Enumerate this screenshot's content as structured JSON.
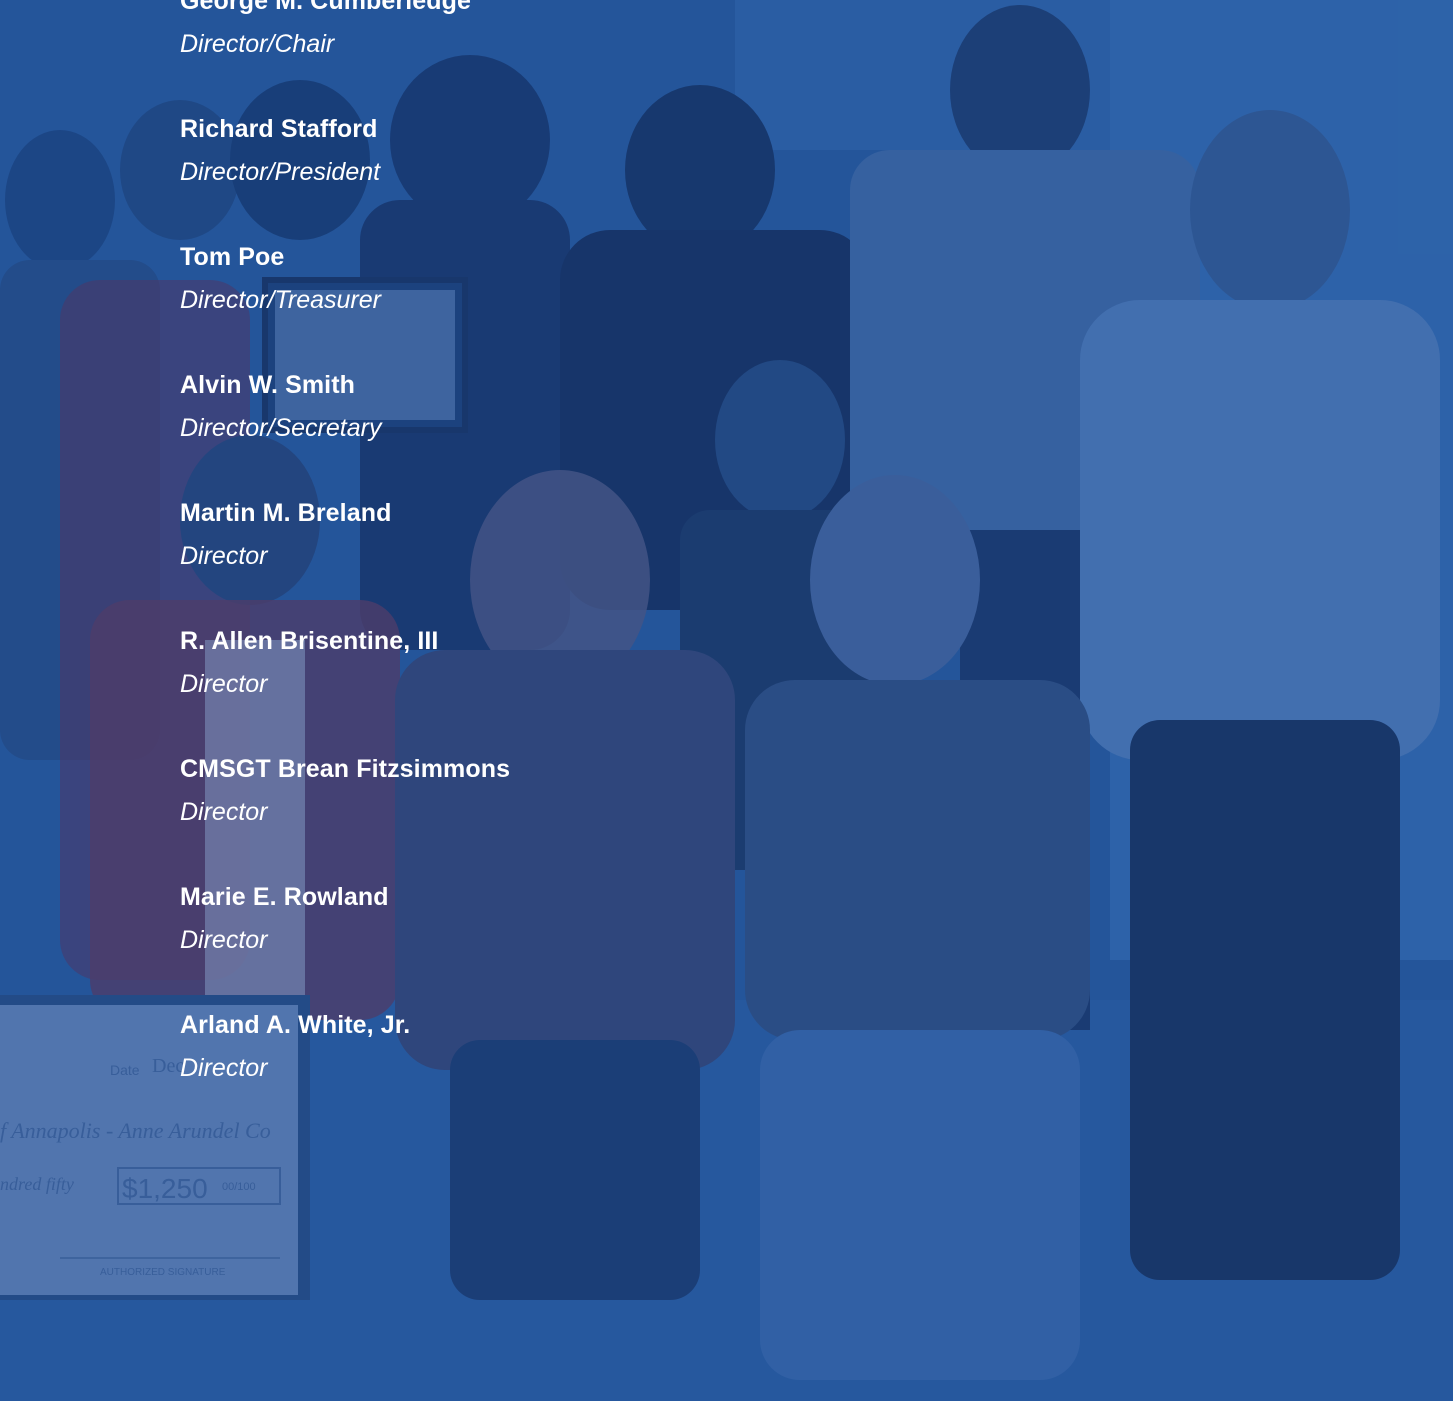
{
  "board": {
    "directors": [
      {
        "name": "George M. Cumberledge",
        "role": "Director/Chair"
      },
      {
        "name": "Richard Stafford",
        "role": "Director/President"
      },
      {
        "name": "Tom Poe",
        "role": "Director/Treasurer"
      },
      {
        "name": "Alvin W. Smith",
        "role": "Director/Secretary"
      },
      {
        "name": "Martin M. Breland",
        "role": "Director"
      },
      {
        "name": "R. Allen Brisentine, III",
        "role": "Director"
      },
      {
        "name": "CMSGT Brean Fitzsimmons",
        "role": "Director"
      },
      {
        "name": "Marie E. Rowland",
        "role": "Director"
      },
      {
        "name": "Arland A. White, Jr.",
        "role": "Director"
      }
    ]
  },
  "photo": {
    "check_text": {
      "date_label": "Date",
      "date_value": "Dec",
      "payee": "f Annapolis - Anne Arundel Co",
      "amount_words": "ndred fifty",
      "amount": "$1,250",
      "cents": "00/100",
      "signature_label": "AUTHORIZED SIGNATURE"
    }
  },
  "colors": {
    "overlay": "#1e4e8f",
    "text": "#ffffff"
  }
}
